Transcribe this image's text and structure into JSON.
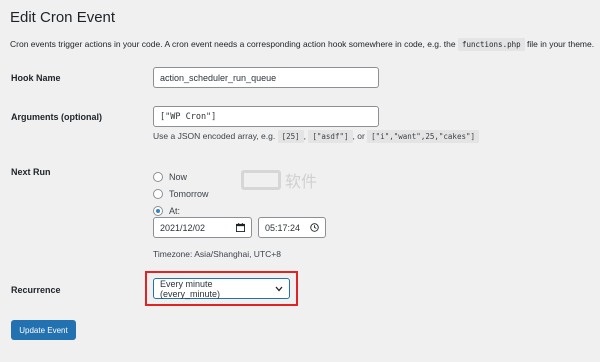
{
  "page": {
    "title": "Edit Cron Event",
    "intro_before": "Cron events trigger actions in your code. A cron event needs a corresponding action hook somewhere in code, e.g. the ",
    "intro_code": "functions.php",
    "intro_after": " file in your theme."
  },
  "hook": {
    "label": "Hook Name",
    "value": "action_scheduler_run_queue"
  },
  "arguments": {
    "label": "Arguments (optional)",
    "value": "[\"WP Cron\"]",
    "hint_before": "Use a JSON encoded array, e.g. ",
    "hint_code_1": "[25]",
    "hint_sep_1": ", ",
    "hint_code_2": "[\"asdf\"]",
    "hint_sep_2": ", or ",
    "hint_code_3": "[\"i\",\"want\",25,\"cakes\"]"
  },
  "next_run": {
    "label": "Next Run",
    "options": [
      "Now",
      "Tomorrow",
      "At:"
    ],
    "selected": "At:",
    "date": "2021/12/02",
    "time": "05:17:24",
    "timezone": "Timezone: Asia/Shanghai, UTC+8"
  },
  "recurrence": {
    "label": "Recurrence",
    "selected": "Every minute (every_minute)"
  },
  "submit": {
    "label": "Update Event"
  },
  "watermark": {
    "text": "软件"
  }
}
